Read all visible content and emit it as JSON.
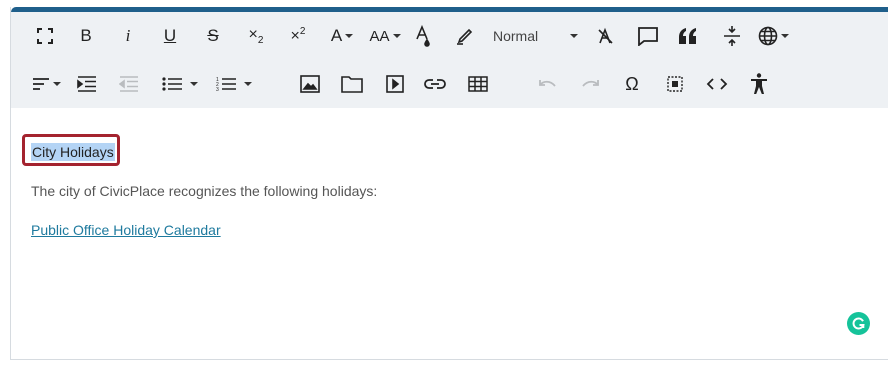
{
  "toolbar": {
    "row1": [
      {
        "name": "fullscreen-icon"
      },
      {
        "name": "bold-button",
        "label": "B"
      },
      {
        "name": "italic-button",
        "label": "i"
      },
      {
        "name": "underline-button",
        "label": "U"
      },
      {
        "name": "strikethrough-button",
        "label": "S"
      },
      {
        "name": "subscript-button"
      },
      {
        "name": "superscript-button"
      },
      {
        "name": "font-color-button",
        "label": "A"
      },
      {
        "name": "font-size-button",
        "label": "AA"
      },
      {
        "name": "background-color-button"
      },
      {
        "name": "highlighter-icon"
      },
      {
        "name": "paragraph-style-select",
        "label": "Normal"
      },
      {
        "name": "clear-formatting-icon"
      },
      {
        "name": "comment-icon"
      },
      {
        "name": "blockquote-icon"
      },
      {
        "name": "page-break-icon"
      },
      {
        "name": "language-globe-icon"
      }
    ],
    "row2": [
      {
        "name": "align-dropdown"
      },
      {
        "name": "indent-increase-icon"
      },
      {
        "name": "indent-decrease-icon"
      },
      {
        "name": "bulleted-list-button"
      },
      {
        "name": "numbered-list-button"
      },
      {
        "name": "insert-image-icon"
      },
      {
        "name": "insert-folder-icon"
      },
      {
        "name": "insert-media-icon"
      },
      {
        "name": "insert-link-icon"
      },
      {
        "name": "insert-table-icon"
      },
      {
        "name": "undo-icon"
      },
      {
        "name": "redo-icon"
      },
      {
        "name": "special-characters-icon",
        "label": "Ω"
      },
      {
        "name": "select-all-icon"
      },
      {
        "name": "source-code-icon"
      },
      {
        "name": "accessibility-icon"
      }
    ]
  },
  "content": {
    "title": "City Holidays",
    "paragraph": "The city of CivicPlace recognizes the following holidays:",
    "link": "Public Office Holiday Calendar"
  },
  "colors": {
    "accent_bar": "#1f5f8b",
    "selection_highlight": "#b4d4f5",
    "callout_border": "#a4232f",
    "link": "#1e7a9e",
    "grammarly": "#15c39a"
  }
}
